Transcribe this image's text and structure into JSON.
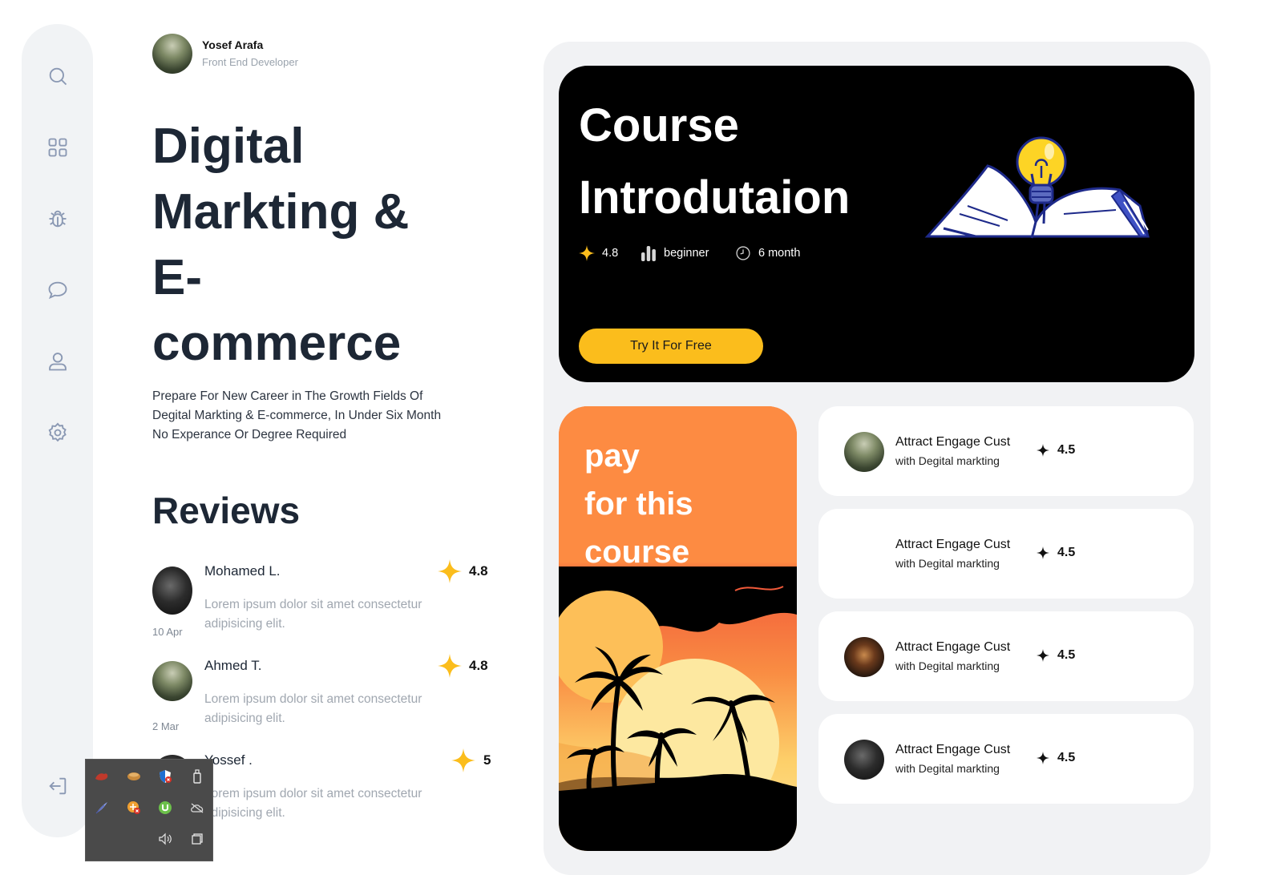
{
  "profile": {
    "name": "Yosef Arafa",
    "role": "Front End Developer"
  },
  "sidebar": {
    "items": [
      {
        "icon": "search-icon"
      },
      {
        "icon": "grid-icon"
      },
      {
        "icon": "bug-icon"
      },
      {
        "icon": "chat-icon"
      },
      {
        "icon": "user-icon"
      },
      {
        "icon": "gear-icon"
      },
      {
        "icon": "logout-icon"
      }
    ]
  },
  "hero": {
    "title_line1": "Digital",
    "title_line2": "Markting &",
    "title_line3": "E-",
    "title_line4": "commerce",
    "desc_line1": "Prepare For New Career in The Growth Fields Of",
    "desc_line2": "Degital Markting & E-commerce, In Under Six Month",
    "desc_line3": "No Experance Or Degree Required"
  },
  "reviews": {
    "title": "Reviews",
    "items": [
      {
        "name": "Mohamed L.",
        "score": "4.8",
        "text_line1": "Lorem ipsum dolor sit amet consectetur",
        "text_line2": "adipisicing elit.",
        "date": "10 Apr"
      },
      {
        "name": "Ahmed T.",
        "score": "4.8",
        "text_line1": "Lorem ipsum dolor sit amet consectetur",
        "text_line2": "adipisicing elit.",
        "date": "2 Mar"
      },
      {
        "name": "Yossef .",
        "score": "5",
        "text_line1": "Lorem ipsum dolor sit amet consectetur",
        "text_line2": "adipisicing elit.",
        "date": ""
      }
    ]
  },
  "course": {
    "title_line1": "Course",
    "title_line2": "Introdutaion",
    "rating": "4.8",
    "level": "beginner",
    "duration": "6 month",
    "cta": "Try It For Free"
  },
  "pay_card": {
    "line1": "pay",
    "line2": "for this",
    "line3": "course"
  },
  "mini_cards": [
    {
      "title": "Attract Engage Cust",
      "subtitle": "with Degital markting",
      "score": "4.5"
    },
    {
      "title": "Attract Engage Cust",
      "subtitle": "with Degital markting",
      "score": "4.5"
    },
    {
      "title": "Attract Engage Cust",
      "subtitle": "with Degital markting",
      "score": "4.5"
    },
    {
      "title": "Attract Engage Cust",
      "subtitle": "with Degital markting",
      "score": "4.5"
    }
  ],
  "colors": {
    "accent": "#fbbd1c",
    "orange": "#fd8b42",
    "sidebar_bg": "#f1f3f5",
    "panel_bg": "#f1f2f4"
  },
  "tray": {
    "icons": [
      "app-red-icon",
      "app-bread-icon",
      "shield-icon",
      "usb-icon",
      "feather-icon",
      "network-icon",
      "torrent-icon",
      "cloud-off-icon",
      "volume-icon",
      "windows-icon"
    ]
  }
}
